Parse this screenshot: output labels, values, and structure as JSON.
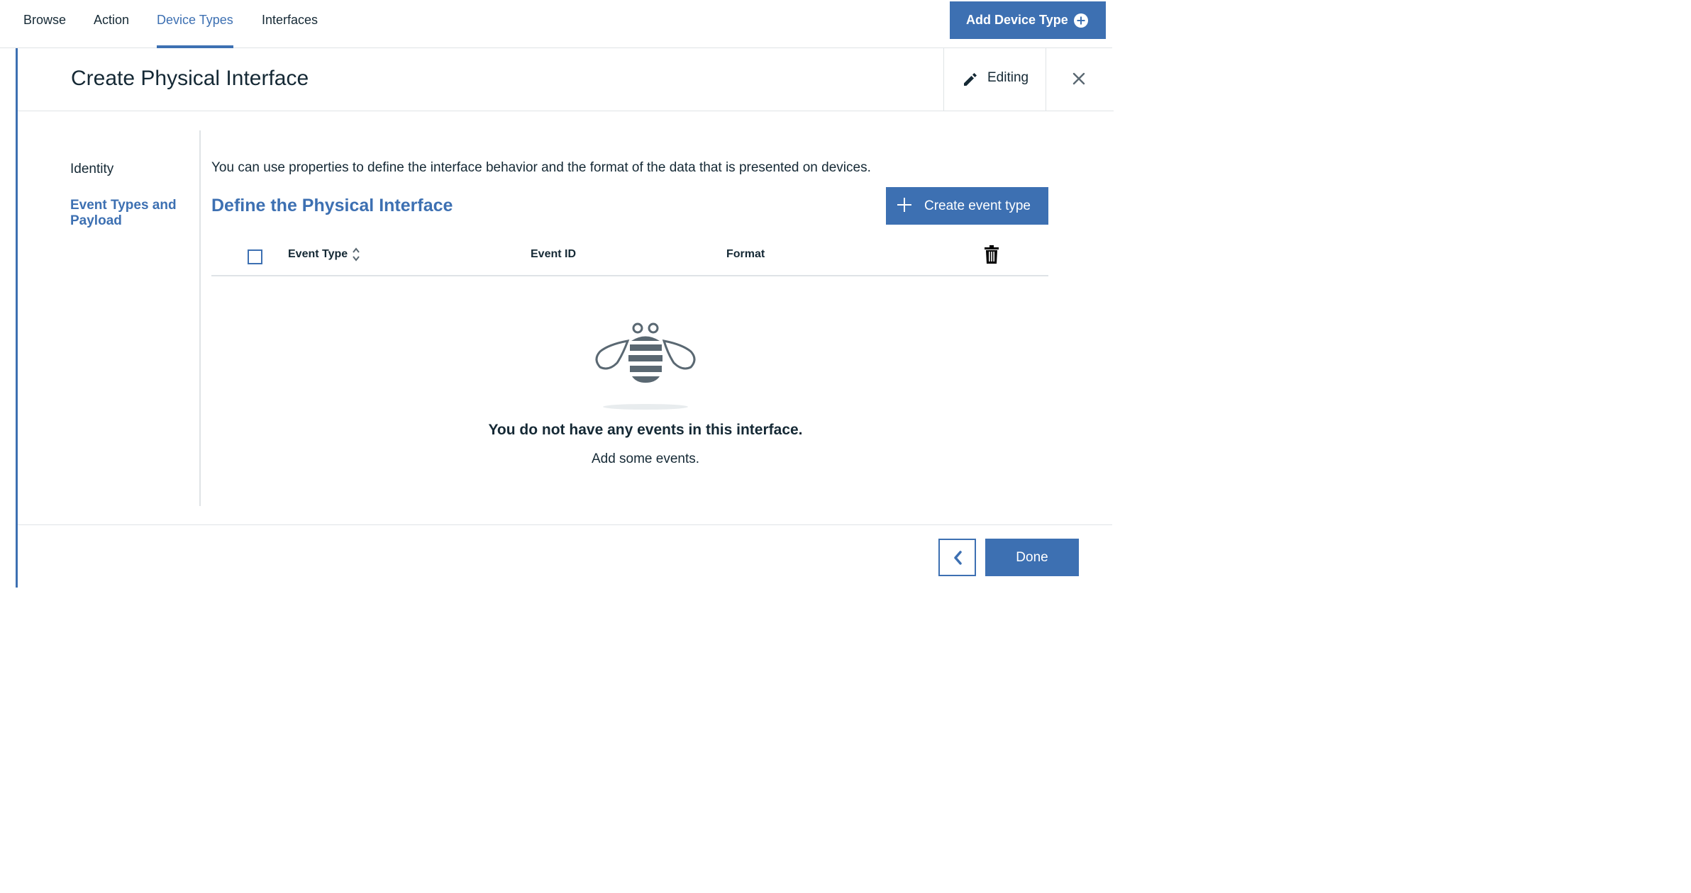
{
  "nav": {
    "tabs": [
      {
        "label": "Browse"
      },
      {
        "label": "Action"
      },
      {
        "label": "Device Types"
      },
      {
        "label": "Interfaces"
      }
    ],
    "active_tab": "Device Types",
    "add_button_label": "Add Device Type",
    "add_button_icon": "plus-circle-icon"
  },
  "modal": {
    "title": "Create Physical Interface",
    "editing_label": "Editing",
    "editing_icon": "pencil-icon",
    "close_icon": "close-icon"
  },
  "steps": [
    {
      "label": "Identity",
      "active": false
    },
    {
      "label": "Event Types and Payload",
      "active": true
    }
  ],
  "content": {
    "description": "You can use properties to define the interface behavior and the format of the data that is presented on devices.",
    "section_title": "Define the Physical Interface",
    "create_button_label": "Create event type",
    "table": {
      "columns": [
        "Event Type",
        "Event ID",
        "Format"
      ],
      "rows": []
    },
    "empty_state": {
      "illustration": "bee-icon",
      "title": "You do not have any events in this interface.",
      "subtitle": "Add some events."
    }
  },
  "footer": {
    "back_icon": "chevron-left-icon",
    "done_label": "Done"
  },
  "colors": {
    "accent": "#3d70b2",
    "text": "#152935",
    "border": "#dfe3e6",
    "illustration": "#5a6872"
  }
}
